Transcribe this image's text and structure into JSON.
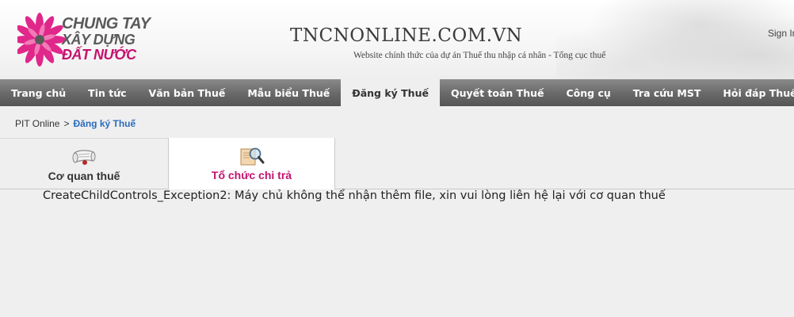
{
  "header": {
    "logo": {
      "line1": "CHUNG TAY",
      "line2": "XÂY DỰNG",
      "line3": "ĐẤT NƯỚC"
    },
    "site_title": "TNCNONLINE.COM.VN",
    "site_subtitle": "Website chính thức của dự án Thuế thu nhập cá nhân - Tổng cục thuế",
    "sign_in": "Sign In"
  },
  "nav": {
    "items": [
      {
        "label": "Trang chủ"
      },
      {
        "label": "Tin tức"
      },
      {
        "label": "Văn bản Thuế"
      },
      {
        "label": "Mẫu biểu Thuế"
      },
      {
        "label": "Đăng ký Thuế"
      },
      {
        "label": "Quyết toán Thuế"
      },
      {
        "label": "Công cụ"
      },
      {
        "label": "Tra cứu MST"
      },
      {
        "label": "Hỏi đáp Thuế"
      }
    ],
    "active": "Đăng ký Thuế"
  },
  "breadcrumb": {
    "root": "PIT Online",
    "separator": ">",
    "current": "Đăng ký Thuế"
  },
  "tabs": [
    {
      "label": "Cơ quan thuế",
      "icon": "scroll-icon"
    },
    {
      "label": "Tổ chức chi trả",
      "icon": "magnifier-icon"
    }
  ],
  "active_tab": "Tổ chức chi trả",
  "message": "CreateChildControls_Exception2: Máy chủ không thể nhận thêm file, xin vui lòng liên hệ lại với cơ quan thuế",
  "colors": {
    "accent": "#c4126e",
    "link": "#2a6bbd",
    "nav_bg": "#6b6b6b"
  }
}
